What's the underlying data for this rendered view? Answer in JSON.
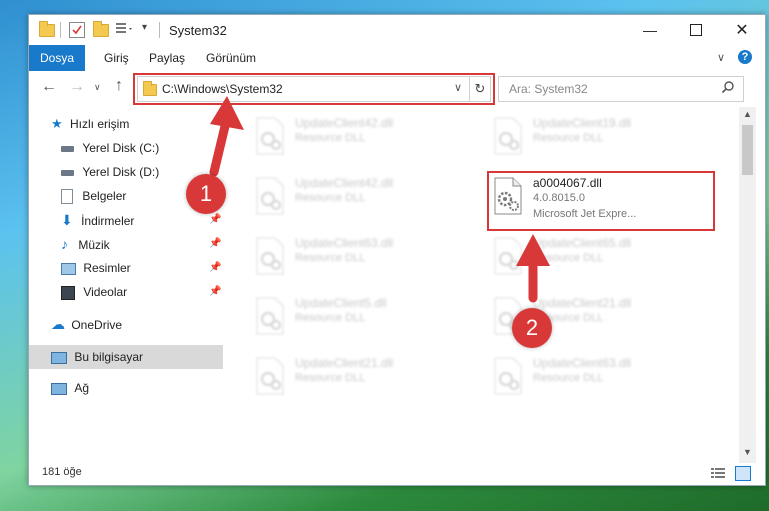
{
  "window": {
    "title": "System32"
  },
  "ribbon": {
    "tabs": [
      "Dosya",
      "Giriş",
      "Paylaş",
      "Görünüm"
    ]
  },
  "nav": {
    "address": "C:\\Windows\\System32",
    "search_placeholder": "Ara: System32"
  },
  "sidebar": {
    "items": [
      {
        "label": "Hızlı erişim",
        "icon": "star-icon"
      },
      {
        "label": "Yerel Disk (C:)",
        "icon": "drive-icon"
      },
      {
        "label": "Yerel Disk (D:)",
        "icon": "drive-icon"
      },
      {
        "label": "Belgeler",
        "icon": "document-icon"
      },
      {
        "label": "İndirmeler",
        "icon": "download-icon"
      },
      {
        "label": "Müzik",
        "icon": "music-icon"
      },
      {
        "label": "Resimler",
        "icon": "pictures-icon"
      },
      {
        "label": "Videolar",
        "icon": "video-icon"
      },
      {
        "label": "OneDrive",
        "icon": "cloud-icon"
      },
      {
        "label": "Bu bilgisayar",
        "icon": "computer-icon"
      },
      {
        "label": "Ağ",
        "icon": "network-icon"
      }
    ],
    "selected": "Bu bilgisayar"
  },
  "files": {
    "left": [
      {
        "name": "UpdateClient42.dll",
        "sub": "Resource DLL"
      },
      {
        "name": "UpdateClient42.dll",
        "sub": "Resource DLL"
      },
      {
        "name": "UpdateClient63.dll",
        "sub": "Resource DLL"
      },
      {
        "name": "UpdateClient5.dll",
        "sub": "Resource DLL"
      },
      {
        "name": "UpdateClient21.dll",
        "sub": "Resource DLL"
      }
    ],
    "right": [
      {
        "name": "UpdateClient19.dll",
        "sub": "Resource DLL"
      },
      {
        "name": "UpdateClient65.dll",
        "sub": "Resource DLL"
      },
      {
        "name": "UpdateClient21.dll",
        "sub": "Resource DLL"
      },
      {
        "name": "UpdateClient63.dll",
        "sub": "Resource DLL"
      }
    ],
    "highlighted": {
      "name": "a0004067.dll",
      "version": "4.0.8015.0",
      "description": "Microsoft Jet Expre..."
    }
  },
  "annotations": {
    "step1": "1",
    "step2": "2"
  },
  "status": {
    "count": "181 öğe"
  },
  "colors": {
    "accent": "#1979ca",
    "highlight": "#d93838"
  }
}
